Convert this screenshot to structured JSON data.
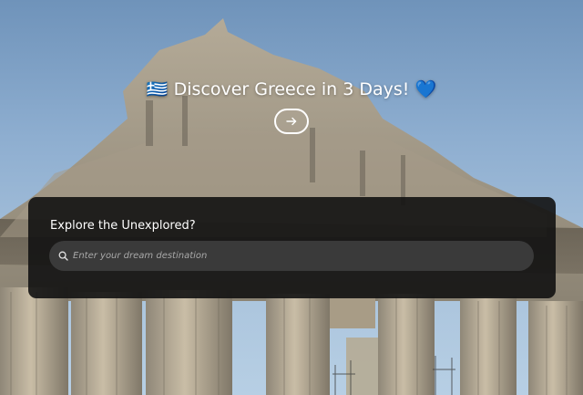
{
  "hero": {
    "title": "🇬🇷 Discover Greece in 3 Days! 💙",
    "arrow_icon": "arrow-right-icon"
  },
  "search_panel": {
    "heading": "Explore the Unexplored?",
    "search_icon": "search-icon",
    "placeholder": "Enter your dream destination",
    "value": ""
  },
  "background": {
    "subject": "Parthenon ruins against blue sky"
  },
  "colors": {
    "panel": "#121212",
    "input": "#3a3a3a",
    "text": "#ffffff"
  }
}
